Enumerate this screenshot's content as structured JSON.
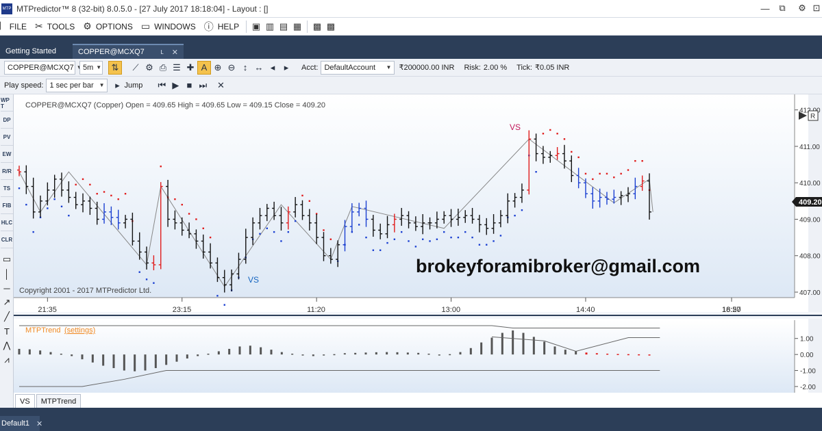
{
  "window": {
    "title": "MTPredictor™ 8 (32-bit) 8.0.5.0 - [27 July 2017 18:18:04] - Layout : []",
    "logo_text": "MTP"
  },
  "menu": {
    "items": [
      {
        "label": "FILE",
        "icon": "file-icon"
      },
      {
        "label": "TOOLS",
        "icon": "tools-icon"
      },
      {
        "label": "OPTIONS",
        "icon": "gear-icon"
      },
      {
        "label": "WINDOWS",
        "icon": "windows-icon"
      },
      {
        "label": "HELP",
        "icon": "help-icon"
      }
    ]
  },
  "tabs": {
    "getting_started": "Getting Started",
    "chart": "COPPER@MCXQ7",
    "chart_close": "ʟ",
    "chart_close2": "✕"
  },
  "chart_toolbar": {
    "symbol": "COPPER@MCXQ7",
    "timeframe": "5m",
    "acct_label": "Acct:",
    "acct_value": "DefaultAccount",
    "balance": "₹200000.00 INR",
    "risk_label": "Risk:",
    "risk_value": "2.00 %",
    "tick_label": "Tick:",
    "tick_value": "₹0.05 INR"
  },
  "playback": {
    "speed_label": "Play speed:",
    "speed_value": "1 sec per bar",
    "jump_label": "Jump"
  },
  "left_tools": [
    "WP T",
    "DP",
    "PV",
    "EW",
    "R/R",
    "TS",
    "FIB",
    "HLC",
    "CLR"
  ],
  "chart": {
    "ohlc_header": "COPPER@MCXQ7 (Copper) Open = 409.65 High = 409.65 Low = 409.15 Close = 409.20",
    "copyright": "Copyright 2001 - 2017 MTPredictor Ltd.",
    "watermark": "brokeyforamibroker@gmail.com",
    "last_price": "409.20",
    "vs_top": "VS",
    "vs_bottom": "VS",
    "indicator_title": "MTPTrend",
    "indicator_settings": "(settings)",
    "right_ctrl": "R"
  },
  "chart_data": {
    "type": "bar",
    "x_ticks": [
      "21:35",
      "23:15",
      "11:20",
      "13:00",
      "14:40",
      "16:20",
      "18:57"
    ],
    "y_ticks": [
      "412.00",
      "411.00",
      "410.00",
      "409.00",
      "408.00",
      "407.00"
    ],
    "ylim": [
      406.85,
      412.2
    ],
    "closes": [
      410.3,
      409.9,
      409.2,
      409.5,
      409.8,
      410.1,
      409.8,
      409.6,
      409.4,
      409.5,
      409.3,
      409.0,
      409.2,
      409.05,
      408.9,
      409.0,
      408.4,
      408.1,
      407.8,
      407.75,
      409.9,
      409.0,
      408.9,
      408.7,
      408.6,
      408.4,
      408.1,
      407.8,
      407.4,
      407.2,
      407.5,
      407.9,
      408.5,
      408.9,
      409.1,
      409.3,
      409.1,
      408.9,
      409.2,
      409.4,
      409.1,
      408.9,
      408.5,
      408.0,
      407.9,
      408.3,
      408.8,
      409.2,
      409.3,
      409.0,
      408.7,
      408.6,
      408.85,
      409.0,
      409.1,
      408.9,
      408.8,
      408.9,
      408.9,
      409.0,
      409.1,
      409.0,
      409.05,
      409.1,
      409.0,
      408.85,
      408.75,
      408.9,
      409.1,
      409.5,
      409.6,
      409.8,
      411.2,
      410.8,
      410.7,
      410.75,
      410.8,
      410.6,
      410.2,
      410.0,
      409.7,
      409.5,
      409.6,
      409.55,
      409.6,
      409.65,
      409.7,
      409.9,
      410.05,
      409.2
    ],
    "osc_ticks": [
      "1.00",
      "0.00",
      "-1.00",
      "-2.00"
    ],
    "osc_values": [
      0.35,
      0.32,
      0.25,
      0.15,
      0.05,
      -0.1,
      -0.3,
      -0.5,
      -0.7,
      -0.85,
      -1.0,
      -1.05,
      -1.0,
      -0.85,
      -0.65,
      -0.45,
      -0.25,
      -0.1,
      0.05,
      0.2,
      0.35,
      0.5,
      0.55,
      0.45,
      0.3,
      0.15,
      0.05,
      -0.05,
      -0.1,
      -0.05,
      0.02,
      0.08,
      0.1,
      0.12,
      0.14,
      0.15,
      0.14,
      0.12,
      0.1,
      0.05,
      0.0,
      0.02,
      0.15,
      0.4,
      0.75,
      1.05,
      1.35,
      1.5,
      1.35,
      1.1,
      0.8,
      0.5,
      0.3,
      0.2,
      0.12,
      0.08,
      0.05,
      0.03,
      0.02,
      0.01,
      0.0
    ],
    "osc_ylim": [
      -2.3,
      1.8
    ]
  }
}
